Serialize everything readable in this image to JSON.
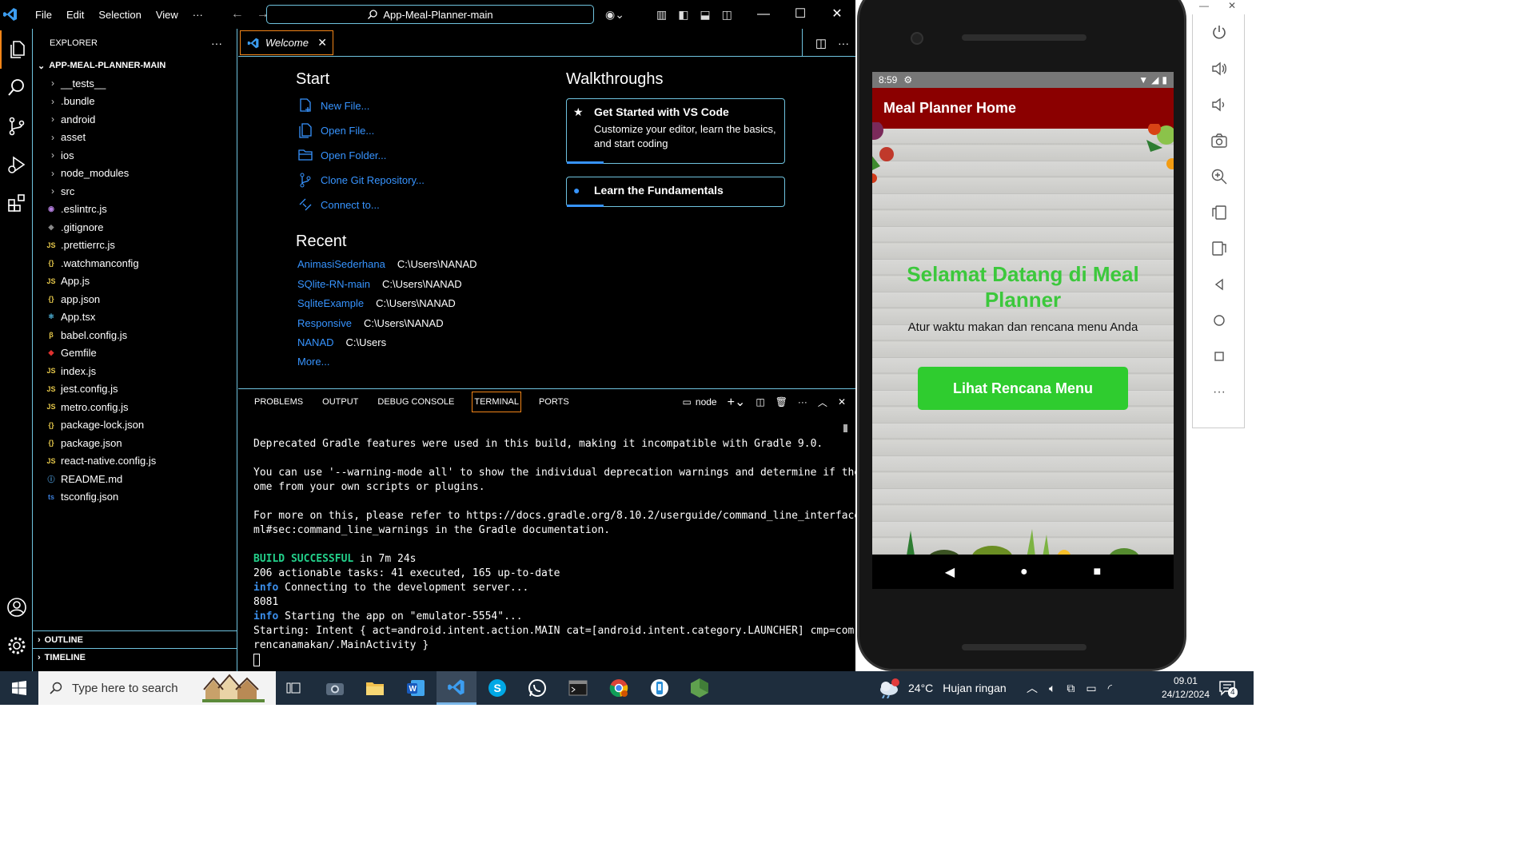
{
  "vscode": {
    "menu": [
      "File",
      "Edit",
      "Selection",
      "View",
      "···"
    ],
    "command_center": "App-Meal-Planner-main",
    "sidebar": {
      "title": "EXPLORER",
      "root": "APP-MEAL-PLANNER-MAIN",
      "folders": [
        "__tests__",
        ".bundle",
        "android",
        "asset",
        "ios",
        "node_modules",
        "src"
      ],
      "files": [
        {
          "name": ".eslintrc.js",
          "icon": "eslint-icon",
          "color": "#b57fe0",
          "glyph": "◉"
        },
        {
          "name": ".gitignore",
          "icon": "git-icon",
          "color": "#888888",
          "glyph": "◆"
        },
        {
          "name": ".prettierrc.js",
          "icon": "js-icon",
          "color": "#e6c84a",
          "glyph": "JS"
        },
        {
          "name": ".watchmanconfig",
          "icon": "json-icon",
          "color": "#e6c84a",
          "glyph": "{}"
        },
        {
          "name": "App.js",
          "icon": "js-icon",
          "color": "#e6c84a",
          "glyph": "JS"
        },
        {
          "name": "app.json",
          "icon": "json-icon",
          "color": "#e6c84a",
          "glyph": "{}"
        },
        {
          "name": "App.tsx",
          "icon": "react-icon",
          "color": "#4fb3d9",
          "glyph": "⚛"
        },
        {
          "name": "babel.config.js",
          "icon": "babel-icon",
          "color": "#e6c84a",
          "glyph": "β"
        },
        {
          "name": "Gemfile",
          "icon": "ruby-icon",
          "color": "#e0312f",
          "glyph": "◆"
        },
        {
          "name": "index.js",
          "icon": "js-icon",
          "color": "#e6c84a",
          "glyph": "JS"
        },
        {
          "name": "jest.config.js",
          "icon": "js-icon",
          "color": "#e6c84a",
          "glyph": "JS"
        },
        {
          "name": "metro.config.js",
          "icon": "js-icon",
          "color": "#e6c84a",
          "glyph": "JS"
        },
        {
          "name": "package-lock.json",
          "icon": "json-icon",
          "color": "#e6c84a",
          "glyph": "{}"
        },
        {
          "name": "package.json",
          "icon": "json-icon",
          "color": "#e6c84a",
          "glyph": "{}"
        },
        {
          "name": "react-native.config.js",
          "icon": "js-icon",
          "color": "#e6c84a",
          "glyph": "JS"
        },
        {
          "name": "README.md",
          "icon": "info-icon",
          "color": "#4fa0e0",
          "glyph": "ⓘ"
        },
        {
          "name": "tsconfig.json",
          "icon": "ts-icon",
          "color": "#3b7dd8",
          "glyph": "ts"
        }
      ],
      "outline": "OUTLINE",
      "timeline": "TIMELINE"
    },
    "tab": {
      "label": "Welcome"
    },
    "welcome": {
      "start_title": "Start",
      "start_links": [
        "New File...",
        "Open File...",
        "Open Folder...",
        "Clone Git Repository...",
        "Connect to..."
      ],
      "recent_title": "Recent",
      "recent": [
        {
          "name": "AnimasiSederhana",
          "path": "C:\\Users\\NANAD"
        },
        {
          "name": "SQlite-RN-main",
          "path": "C:\\Users\\NANAD"
        },
        {
          "name": "SqliteExample",
          "path": "C:\\Users\\NANAD"
        },
        {
          "name": "Responsive",
          "path": "C:\\Users\\NANAD"
        },
        {
          "name": "NANAD",
          "path": "C:\\Users"
        }
      ],
      "more": "More...",
      "walkthroughs_title": "Walkthroughs",
      "card1_title": "Get Started with VS Code",
      "card1_desc": "Customize your editor, learn the basics, and start coding",
      "card2_title": "Learn the Fundamentals"
    },
    "panel": {
      "tabs": [
        "PROBLEMS",
        "OUTPUT",
        "DEBUG CONSOLE",
        "TERMINAL",
        "PORTS"
      ],
      "active_tab": "TERMINAL",
      "shell": "node"
    },
    "terminal": {
      "line1": "Deprecated Gradle features were used in this build, making it incompatible with Gradle 9.0.",
      "line2": "You can use '--warning-mode all' to show the individual deprecation warnings and determine if they c",
      "line3": "ome from your own scripts or plugins.",
      "line4": "For more on this, please refer to https://docs.gradle.org/8.10.2/userguide/command_line_interface.ht",
      "line5": "ml#sec:command_line_warnings in the Gradle documentation.",
      "build_ok": "BUILD SUCCESSFUL",
      "build_time": " in 7m 24s",
      "line7": "206 actionable tasks: 41 executed, 165 up-to-date",
      "info": "info",
      "line8": " Connecting to the development server...",
      "line9": "8081",
      "line10": " Starting the app on \"emulator-5554\"...",
      "line11": "Starting: Intent { act=android.intent.action.MAIN cat=[android.intent.category.LAUNCHER] cmp=com.app",
      "line12": "rencanamakan/.MainActivity }"
    }
  },
  "emulator": {
    "status_time": "8:59",
    "app_bar_title": "Meal Planner Home",
    "heading": "Selamat Datang di Meal Planner",
    "subheading": "Atur waktu makan dan rencana menu Anda",
    "button": "Lihat Rencana Menu",
    "accent_red": "#8b0000",
    "accent_green": "#2fcc2f"
  },
  "taskbar": {
    "search_placeholder": "Type here to search",
    "weather_temp": "24°C",
    "weather_text": "Hujan ringan",
    "time": "09.01",
    "date": "24/12/2024",
    "notification_count": "4"
  }
}
